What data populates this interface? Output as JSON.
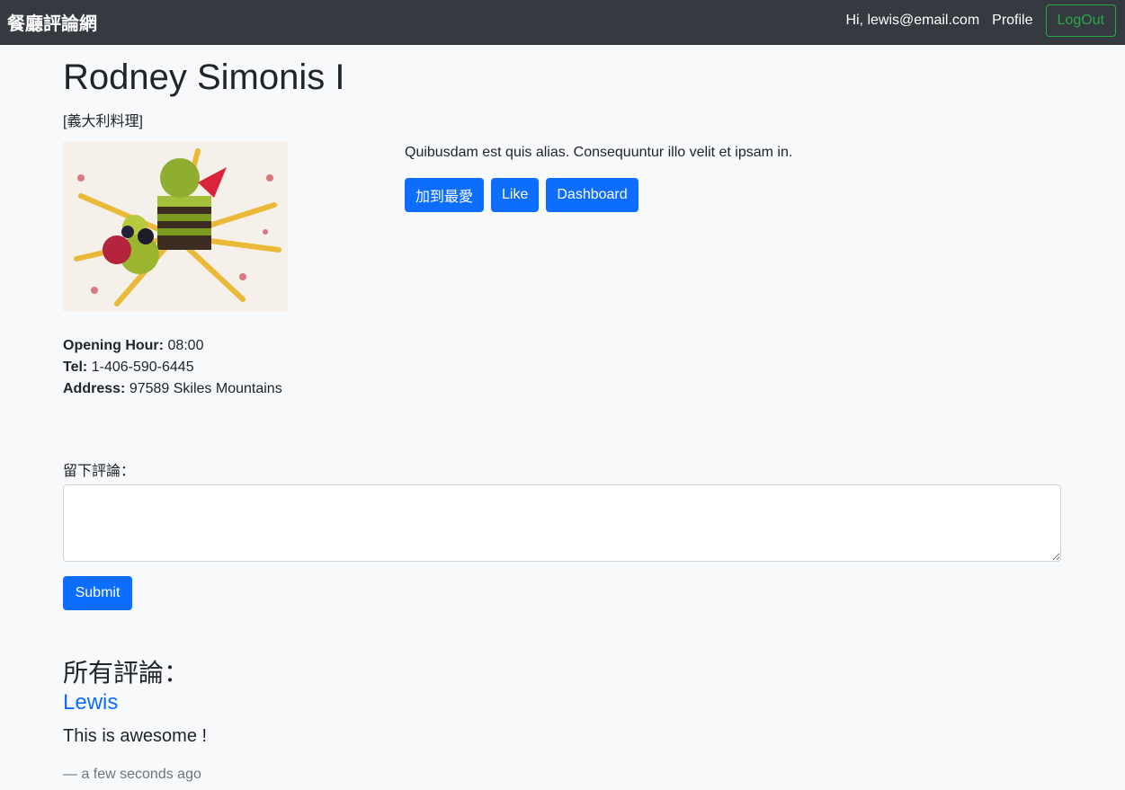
{
  "navbar": {
    "brand": "餐廳評論網",
    "greeting": "Hi, lewis@email.com",
    "profile_label": "Profile",
    "logout_label": "LogOut"
  },
  "restaurant": {
    "name": "Rodney Simonis I",
    "category": "[義大利料理]",
    "description": "Quibusdam est quis alias. Consequuntur illo velit et ipsam in.",
    "opening_hour_label": "Opening Hour:",
    "opening_hour": "08:00",
    "tel_label": "Tel:",
    "tel": "1-406-590-6445",
    "address_label": "Address:",
    "address": "97589 Skiles Mountains"
  },
  "actions": {
    "favorite_label": "加到最愛",
    "like_label": "Like",
    "dashboard_label": "Dashboard"
  },
  "comment_form": {
    "label": "留下評論：",
    "value": "",
    "submit_label": "Submit"
  },
  "comments": {
    "heading": "所有評論：",
    "items": [
      {
        "author": "Lewis",
        "text": "This is awesome !",
        "time": "— a few seconds ago"
      }
    ]
  },
  "colors": {
    "navbar_bg": "#343a40",
    "primary": "#0d6efd",
    "logout_green": "#28a745"
  }
}
